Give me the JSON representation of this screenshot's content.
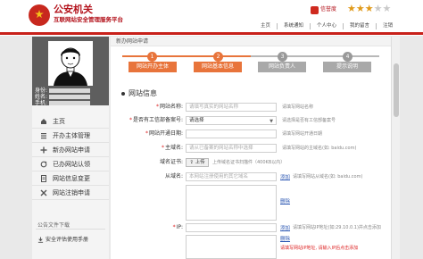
{
  "header": {
    "title": "公安机关",
    "subtitle": "互联网站安全管理服务平台",
    "badge": "信誉度",
    "stars": [
      "★",
      "★",
      "★",
      "★",
      "★"
    ],
    "nav": [
      "主页",
      "系统通知",
      "个人中心",
      "我的留言",
      "注销"
    ]
  },
  "sidebar": {
    "meta": [
      "身份:",
      "姓名:",
      "手机:"
    ],
    "menu": [
      "主页",
      "开办主体管理",
      "新办网站申请",
      "已办网站认领",
      "网站信息变更",
      "网站注销申请"
    ],
    "menu_icons": [
      "home-icon",
      "list-icon",
      "plus-icon",
      "refresh-icon",
      "document-icon",
      "close-icon"
    ],
    "docs_title": "公告文件下载",
    "docs_item": "安全评估使用手册"
  },
  "breadcrumb": "新办网站申请",
  "steps": [
    {
      "num": "1",
      "label": "网站开办主体"
    },
    {
      "num": "2",
      "label": "网站基本信息"
    },
    {
      "num": "3",
      "label": "网站负责人"
    },
    {
      "num": "4",
      "label": "提示说明"
    }
  ],
  "colors": {
    "accent": "#c8211a",
    "step_active": "#e8743b",
    "step_inactive": "#a9a9a9"
  },
  "form": {
    "section": "网站信息",
    "fields": [
      {
        "label": "网站名称:",
        "placeholder": "请填写真实的网站名称",
        "hint": "请填写网站名称"
      },
      {
        "label": "是否有工信部备案号:",
        "value": "请选择",
        "hint": "请选择是否有工信部备案号"
      },
      {
        "label": "网站开通日期:",
        "placeholder": "",
        "hint": "请填写网站开通日期"
      },
      {
        "label": "主域名:",
        "placeholder": "请从已备案的网站名称中选择",
        "hint": "请填写网站的主域名(如: baidu.com)"
      },
      {
        "label": "域名证书:",
        "upload": "上传",
        "hint": "上传域名证书扫描件（400KB以内）"
      },
      {
        "label": "从域名:",
        "placeholder": "本网站注册使用的其它域名",
        "add": "添加",
        "hint": "请填写网站从域名(如: baidu.com)"
      },
      {
        "label": "IP:",
        "add": "添加",
        "hint": "请填写网站IP地址(如:29.10.0.1)并点击添加"
      }
    ],
    "delete": "删除",
    "ip_note": "请填写网站IP地址, 请输入IP后点击添加"
  }
}
